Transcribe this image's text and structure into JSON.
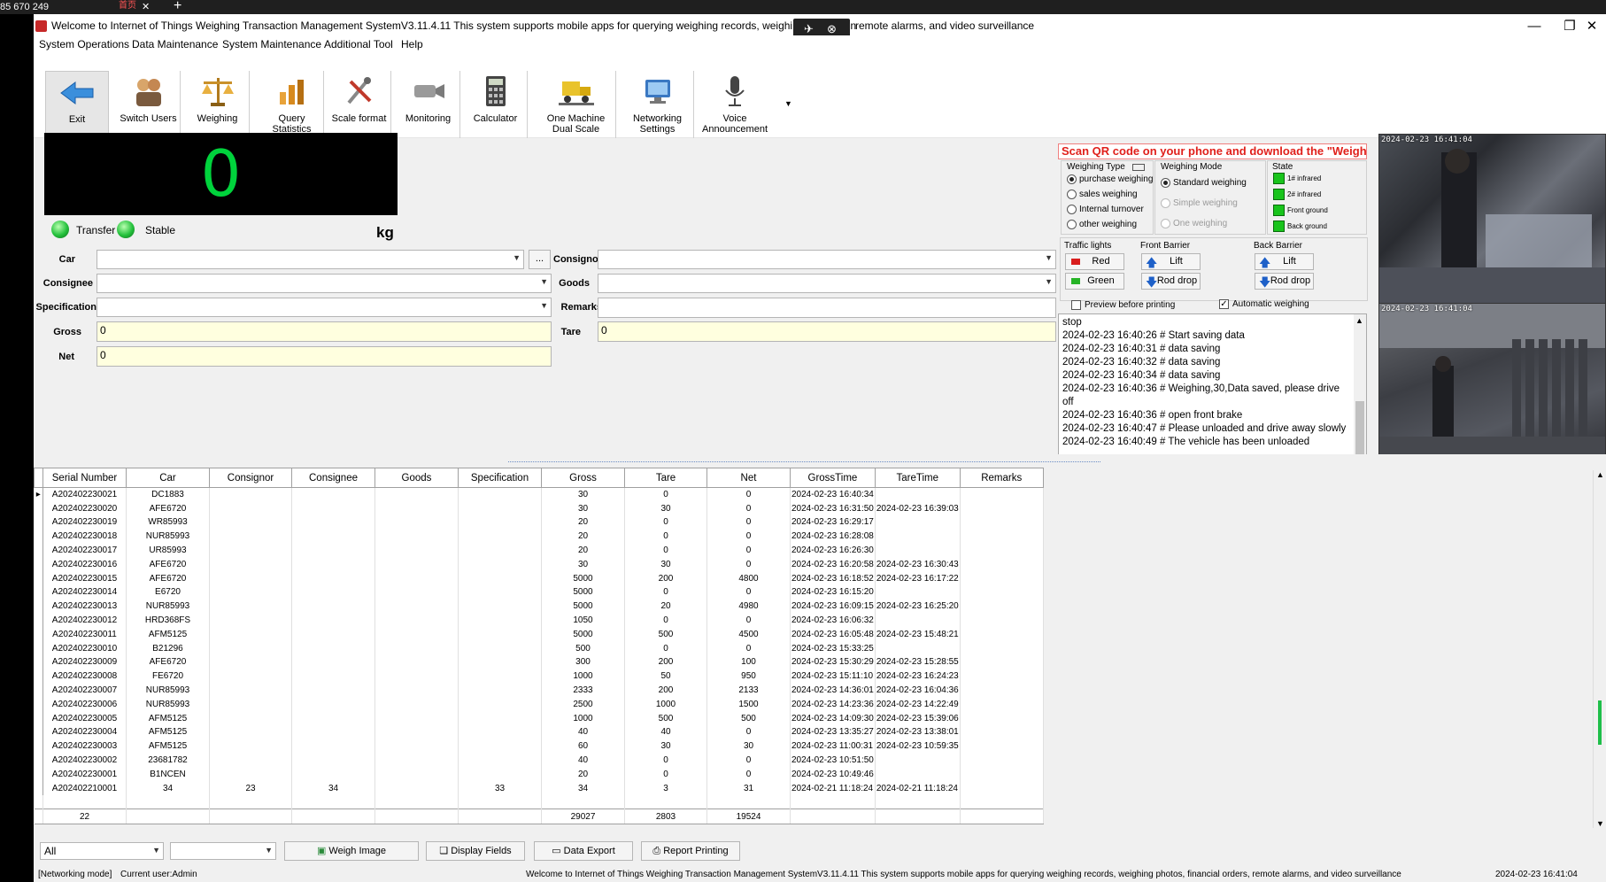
{
  "desktop": {
    "top_left_text": "85 670 249",
    "tab_text": "首页",
    "tab_close": "✕",
    "new_tab": "+"
  },
  "window": {
    "title": "Welcome to Internet of Things Weighing Transaction Management SystemV3.11.4.11 This system supports mobile apps for querying weighing records, weighing photos, fin",
    "title_tail": "remote alarms, and video surveillance",
    "controls": {
      "minimize": "—",
      "maximize": "❐",
      "close": "✕"
    }
  },
  "menu": [
    "System Operations",
    "Data Maintenance",
    "System Maintenance",
    "Additional Tool",
    "Help"
  ],
  "toolbar": [
    {
      "label": "Exit",
      "icon": "exit-arrow-icon"
    },
    {
      "label": "Switch Users",
      "icon": "users-icon"
    },
    {
      "label": "Weighing",
      "icon": "scale-balance-icon"
    },
    {
      "label": "Query Statistics",
      "icon": "bar-chart-icon"
    },
    {
      "label": "Scale format",
      "icon": "tools-icon"
    },
    {
      "label": "Monitoring",
      "icon": "camera-icon"
    },
    {
      "label": "Calculator",
      "icon": "calculator-icon"
    },
    {
      "label": "One Machine Dual Scale",
      "icon": "truck-scale-icon"
    },
    {
      "label": "Networking Settings",
      "icon": "monitor-network-icon"
    },
    {
      "label": "Voice Announcement",
      "icon": "microphone-icon"
    }
  ],
  "weight": {
    "value": "0",
    "unit": "kg",
    "transfer_label": "Transfer",
    "stable_label": "Stable"
  },
  "form": {
    "car_label": "Car",
    "consignor_label": "Consignor",
    "consignee_label": "Consignee",
    "goods_label": "Goods",
    "specification_label": "Specification",
    "remarks_label": "Remarks",
    "gross_label": "Gross",
    "tare_label": "Tare",
    "net_label": "Net",
    "gross_value": "0",
    "tare_value": "0",
    "net_value": "0",
    "more_button": "..."
  },
  "qr_banner": "Scan QR code on your phone and download the \"Weighing",
  "weighing_type": {
    "title": "Weighing Type",
    "options": [
      "purchase weighing",
      "sales weighing",
      "Internal turnover",
      "other weighing"
    ],
    "selected": 0
  },
  "weighing_mode": {
    "title": "Weighing Mode",
    "options": [
      "Standard weighing",
      "Simple weighing",
      "One weighing"
    ],
    "selected": 0
  },
  "state": {
    "title": "State",
    "items": [
      "1# infrared",
      "2# infrared",
      "Front ground",
      "Back ground"
    ]
  },
  "traffic_lights": {
    "title": "Traffic lights",
    "red": "Red",
    "green": "Green"
  },
  "front_barrier": {
    "title": "Front Barrier",
    "lift": "Lift",
    "drop": "Rod drop"
  },
  "back_barrier": {
    "title": "Back Barrier",
    "lift": "Lift",
    "drop": "Rod drop"
  },
  "options": {
    "preview": "Preview before printing",
    "auto": "Automatic weighing",
    "auto_checked": true,
    "preview_checked": false
  },
  "log": [
    "stop",
    "2024-02-23 16:40:26 # Start saving data",
    "2024-02-23 16:40:31 # data saving",
    "2024-02-23 16:40:32 # data saving",
    "2024-02-23 16:40:34 # data saving",
    "2024-02-23 16:40:36 # Weighing,30,Data saved, please drive off",
    "2024-02-23 16:40:36 # open front brake",
    "2024-02-23 16:40:47 # Please unloaded and drive away slowly",
    "2024-02-23 16:40:49 # The vehicle has been unloaded"
  ],
  "cameras": [
    {
      "timestamp": "2024-02-23 16:41:04"
    },
    {
      "timestamp": "2024-02-23 16:41:04"
    }
  ],
  "table": {
    "columns": [
      "Serial Number",
      "Car",
      "Consignor",
      "Consignee",
      "Goods",
      "Specification",
      "Gross",
      "Tare",
      "Net",
      "GrossTime",
      "TareTime",
      "Remarks"
    ],
    "rows": [
      [
        "A202402230021",
        "DC1883",
        "",
        "",
        "",
        "",
        "30",
        "0",
        "0",
        "2024-02-23 16:40:34",
        "",
        ""
      ],
      [
        "A202402230020",
        "AFE6720",
        "",
        "",
        "",
        "",
        "30",
        "30",
        "0",
        "2024-02-23 16:31:50",
        "2024-02-23 16:39:03",
        ""
      ],
      [
        "A202402230019",
        "WR85993",
        "",
        "",
        "",
        "",
        "20",
        "0",
        "0",
        "2024-02-23 16:29:17",
        "",
        ""
      ],
      [
        "A202402230018",
        "NUR85993",
        "",
        "",
        "",
        "",
        "20",
        "0",
        "0",
        "2024-02-23 16:28:08",
        "",
        ""
      ],
      [
        "A202402230017",
        "UR85993",
        "",
        "",
        "",
        "",
        "20",
        "0",
        "0",
        "2024-02-23 16:26:30",
        "",
        ""
      ],
      [
        "A202402230016",
        "AFE6720",
        "",
        "",
        "",
        "",
        "30",
        "30",
        "0",
        "2024-02-23 16:20:58",
        "2024-02-23 16:30:43",
        ""
      ],
      [
        "A202402230015",
        "AFE6720",
        "",
        "",
        "",
        "",
        "5000",
        "200",
        "4800",
        "2024-02-23 16:18:52",
        "2024-02-23 16:17:22",
        ""
      ],
      [
        "A202402230014",
        "E6720",
        "",
        "",
        "",
        "",
        "5000",
        "0",
        "0",
        "2024-02-23 16:15:20",
        "",
        ""
      ],
      [
        "A202402230013",
        "NUR85993",
        "",
        "",
        "",
        "",
        "5000",
        "20",
        "4980",
        "2024-02-23 16:09:15",
        "2024-02-23 16:25:20",
        ""
      ],
      [
        "A202402230012",
        "HRD368FS",
        "",
        "",
        "",
        "",
        "1050",
        "0",
        "0",
        "2024-02-23 16:06:32",
        "",
        ""
      ],
      [
        "A202402230011",
        "AFM5125",
        "",
        "",
        "",
        "",
        "5000",
        "500",
        "4500",
        "2024-02-23 16:05:48",
        "2024-02-23 15:48:21",
        ""
      ],
      [
        "A202402230010",
        "B21296",
        "",
        "",
        "",
        "",
        "500",
        "0",
        "0",
        "2024-02-23 15:33:25",
        "",
        ""
      ],
      [
        "A202402230009",
        "AFE6720",
        "",
        "",
        "",
        "",
        "300",
        "200",
        "100",
        "2024-02-23 15:30:29",
        "2024-02-23 15:28:55",
        ""
      ],
      [
        "A202402230008",
        "FE6720",
        "",
        "",
        "",
        "",
        "1000",
        "50",
        "950",
        "2024-02-23 15:11:10",
        "2024-02-23 16:24:23",
        ""
      ],
      [
        "A202402230007",
        "NUR85993",
        "",
        "",
        "",
        "",
        "2333",
        "200",
        "2133",
        "2024-02-23 14:36:01",
        "2024-02-23 16:04:36",
        ""
      ],
      [
        "A202402230006",
        "NUR85993",
        "",
        "",
        "",
        "",
        "2500",
        "1000",
        "1500",
        "2024-02-23 14:23:36",
        "2024-02-23 14:22:49",
        ""
      ],
      [
        "A202402230005",
        "AFM5125",
        "",
        "",
        "",
        "",
        "1000",
        "500",
        "500",
        "2024-02-23 14:09:30",
        "2024-02-23 15:39:06",
        ""
      ],
      [
        "A202402230004",
        "AFM5125",
        "",
        "",
        "",
        "",
        "40",
        "40",
        "0",
        "2024-02-23 13:35:27",
        "2024-02-23 13:38:01",
        ""
      ],
      [
        "A202402230003",
        "AFM5125",
        "",
        "",
        "",
        "",
        "60",
        "30",
        "30",
        "2024-02-23 11:00:31",
        "2024-02-23 10:59:35",
        ""
      ],
      [
        "A202402230002",
        "23681782",
        "",
        "",
        "",
        "",
        "40",
        "0",
        "0",
        "2024-02-23 10:51:50",
        "",
        ""
      ],
      [
        "A202402230001",
        "B1NCEN",
        "",
        "",
        "",
        "",
        "20",
        "0",
        "0",
        "2024-02-23 10:49:46",
        "",
        ""
      ],
      [
        "A202402210001",
        "34",
        "23",
        "34",
        "",
        "33",
        "34",
        "3",
        "31",
        "2024-02-21 11:18:24",
        "2024-02-21 11:18:24",
        ""
      ]
    ],
    "summary": {
      "count": "22",
      "gross": "29027",
      "tare": "2803",
      "net": "19524"
    }
  },
  "bottom": {
    "filter_value": "All",
    "buttons": [
      "Weigh Image",
      "Display Fields",
      "Data Export",
      "Report Printing"
    ]
  },
  "status": {
    "mode": "[Networking mode]",
    "user": "Current user:Admin",
    "message": "Welcome to Internet of Things Weighing Transaction Management SystemV3.11.4.11 This system supports mobile apps for querying weighing records, weighing photos, financial orders, remote alarms, and video surveillance",
    "datetime": "2024-02-23 16:41:04"
  },
  "colors": {
    "weight_green": "#00d33c",
    "banner_red": "#e0201b",
    "field_yellow": "#ffffdf",
    "state_green": "#19c41c"
  }
}
